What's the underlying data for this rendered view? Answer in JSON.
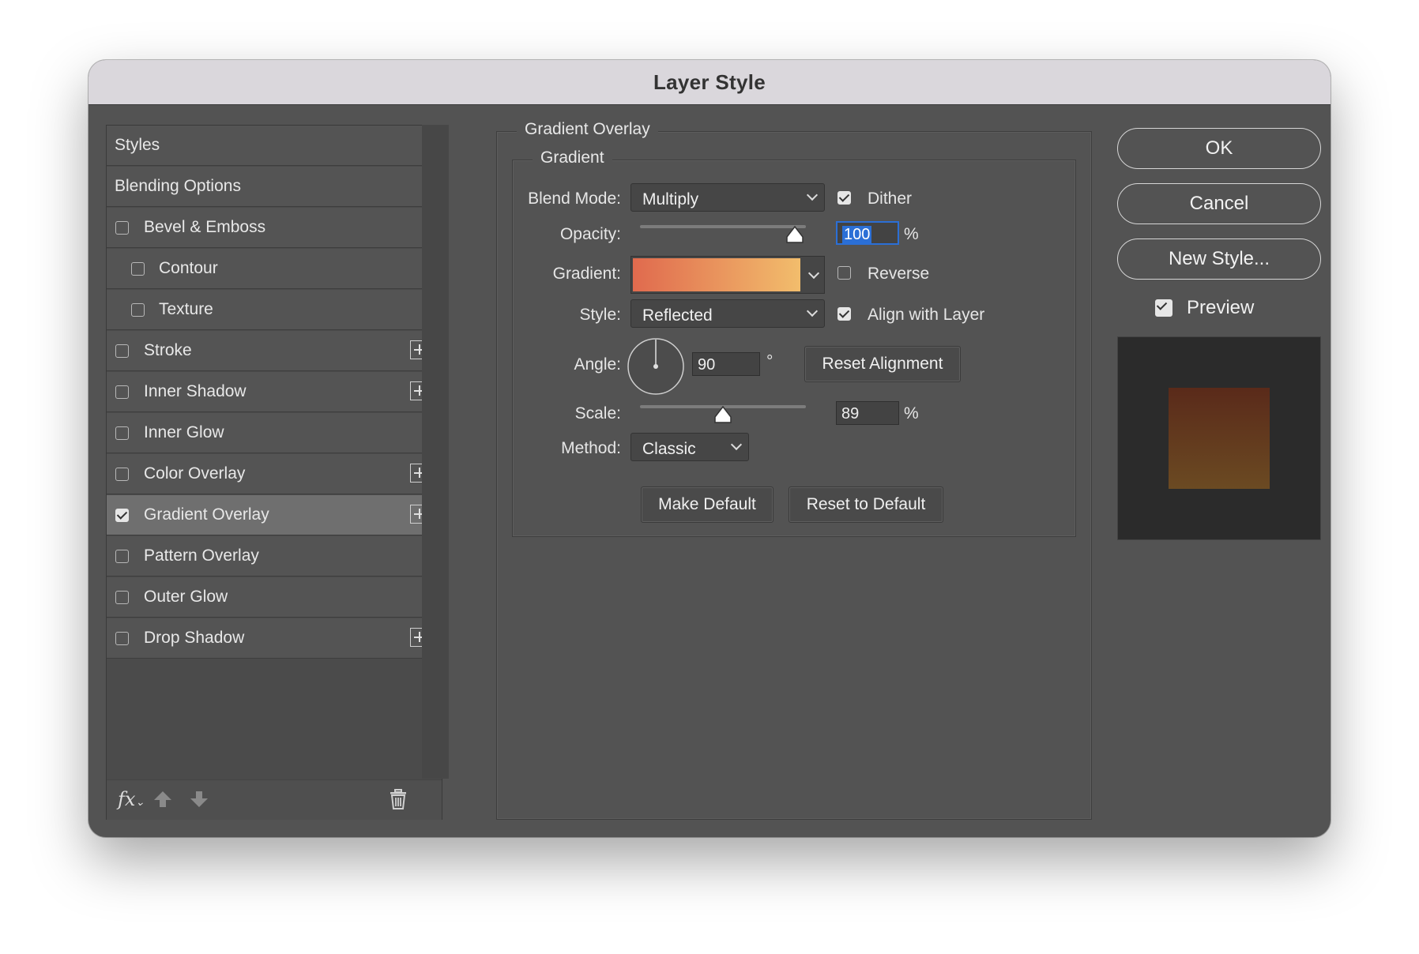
{
  "dialog": {
    "title": "Layer Style"
  },
  "style_list": {
    "items": [
      {
        "label": "Styles",
        "checkbox": false,
        "checked": false,
        "indent": false,
        "plus": false,
        "selected": false
      },
      {
        "label": "Blending Options",
        "checkbox": false,
        "checked": false,
        "indent": false,
        "plus": false,
        "selected": false
      },
      {
        "label": "Bevel & Emboss",
        "checkbox": true,
        "checked": false,
        "indent": false,
        "plus": false,
        "selected": false
      },
      {
        "label": "Contour",
        "checkbox": true,
        "checked": false,
        "indent": true,
        "plus": false,
        "selected": false
      },
      {
        "label": "Texture",
        "checkbox": true,
        "checked": false,
        "indent": true,
        "plus": false,
        "selected": false
      },
      {
        "label": "Stroke",
        "checkbox": true,
        "checked": false,
        "indent": false,
        "plus": true,
        "selected": false
      },
      {
        "label": "Inner Shadow",
        "checkbox": true,
        "checked": false,
        "indent": false,
        "plus": true,
        "selected": false
      },
      {
        "label": "Inner Glow",
        "checkbox": true,
        "checked": false,
        "indent": false,
        "plus": false,
        "selected": false
      },
      {
        "label": "Color Overlay",
        "checkbox": true,
        "checked": false,
        "indent": false,
        "plus": true,
        "selected": false
      },
      {
        "label": "Gradient Overlay",
        "checkbox": true,
        "checked": true,
        "indent": false,
        "plus": true,
        "selected": true
      },
      {
        "label": "Pattern Overlay",
        "checkbox": true,
        "checked": false,
        "indent": false,
        "plus": false,
        "selected": false
      },
      {
        "label": "Outer Glow",
        "checkbox": true,
        "checked": false,
        "indent": false,
        "plus": false,
        "selected": false
      },
      {
        "label": "Drop Shadow",
        "checkbox": true,
        "checked": false,
        "indent": false,
        "plus": true,
        "selected": false
      }
    ],
    "bottom_icons": [
      "fx-icon",
      "arrow-up-icon",
      "arrow-down-icon",
      "trash-icon"
    ],
    "fx_label": "fx"
  },
  "panel": {
    "section_title": "Gradient Overlay",
    "group_title": "Gradient",
    "blend_mode": {
      "label": "Blend Mode:",
      "value": "Multiply"
    },
    "dither": {
      "label": "Dither",
      "checked": true
    },
    "opacity": {
      "label": "Opacity:",
      "value": "100",
      "unit": "%",
      "level": 1.0
    },
    "gradient": {
      "label": "Gradient:",
      "color_start": "#e06a4e",
      "color_end": "#f2bd6c"
    },
    "reverse": {
      "label": "Reverse",
      "checked": false
    },
    "style": {
      "label": "Style:",
      "value": "Reflected"
    },
    "align_with_layer": {
      "label": "Align with Layer",
      "checked": true
    },
    "angle": {
      "label": "Angle:",
      "value": "90",
      "unit": "°"
    },
    "reset_alignment_label": "Reset Alignment",
    "scale": {
      "label": "Scale:",
      "value": "89",
      "unit": "%",
      "level": 0.5
    },
    "method": {
      "label": "Method:",
      "value": "Classic"
    },
    "make_default_label": "Make Default",
    "reset_to_default_label": "Reset to Default"
  },
  "actions": {
    "ok_label": "OK",
    "cancel_label": "Cancel",
    "new_style_label": "New Style...",
    "preview": {
      "label": "Preview",
      "checked": true
    }
  },
  "colors": {
    "dialog_bg": "#535353",
    "titlebar_bg": "#dad7dc",
    "selected_row": "#6f6f6f",
    "preview_bg": "#2b2b2b",
    "preview_swatch_top": "#5a2a1a",
    "preview_swatch_bottom": "#6b4a22",
    "focus_highlight": "#2b6fd6"
  }
}
